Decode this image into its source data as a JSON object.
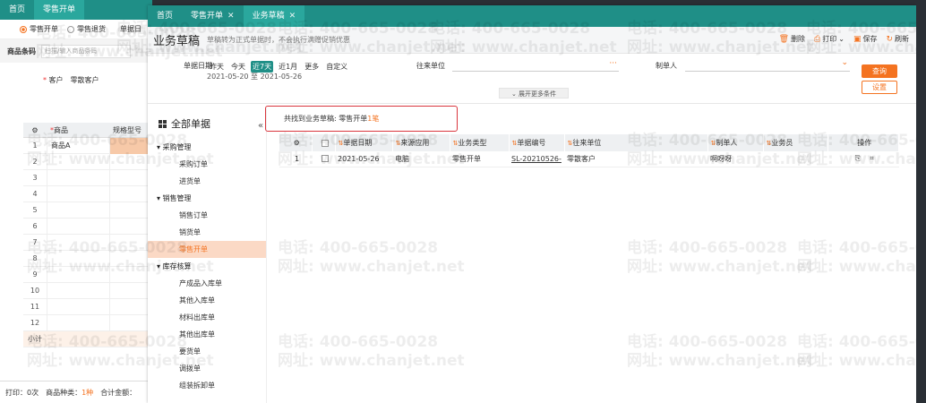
{
  "bg": {
    "tabs": [
      "首页",
      "零售开单"
    ],
    "radio": [
      "零售开单",
      "零售退货"
    ],
    "date_label": "单据日",
    "barcode_label": "商品条码",
    "barcode_placeholder": "扫描/输入商品条码",
    "customer_label": "客户",
    "customer_value": "零散客户",
    "grid_header": [
      "商品",
      "规格型号"
    ],
    "rows": [
      "1",
      "2",
      "3",
      "4",
      "5",
      "6",
      "7",
      "8",
      "9",
      "10",
      "11",
      "12"
    ],
    "first_item": "商品A",
    "subtotal": "小计",
    "footer": {
      "print": "打印：0次",
      "kinds_label": "商品种类：",
      "kinds_value": "1种",
      "amount": "合计金额："
    }
  },
  "win": {
    "tabs": [
      "首页",
      "零售开单",
      "业务草稿"
    ],
    "title": "业务草稿",
    "subtitle": "草稿转为正式单据时，不会执行满赠促销优惠",
    "actions": {
      "delete": "删除",
      "print": "打印",
      "save": "保存",
      "refresh": "刷新"
    },
    "filter": {
      "date_label": "单据日期",
      "quick": [
        "昨天",
        "今天",
        "近7天",
        "近1月",
        "更多",
        "自定义"
      ],
      "active_quick": "近7天",
      "range": "2021-05-20 至 2021-05-26",
      "partner_label": "往来单位",
      "maker_label": "制单人",
      "query": "查询",
      "settings": "设置",
      "expand": "展开更多条件"
    },
    "sidebar": {
      "all": "全部单据",
      "groups": [
        {
          "label": "采购管理",
          "items": [
            "采购订单",
            "进货单"
          ]
        },
        {
          "label": "销售管理",
          "items": [
            "销售订单",
            "销货单",
            "零售开单"
          ]
        },
        {
          "label": "库存核算",
          "items": [
            "产成品入库单",
            "其他入库单",
            "材料出库单",
            "其他出库单",
            "要货单",
            "调拨单",
            "组装拆卸单"
          ]
        }
      ],
      "active": "零售开单"
    },
    "found": {
      "prefix": "共找到业务草稿: 零售开单",
      "count": "1笔"
    },
    "table": {
      "headers": [
        "单据日期",
        "来源应用",
        "业务类型",
        "单据编号",
        "往来单位",
        "制单人",
        "业务员",
        "操作"
      ],
      "rows": [
        {
          "idx": "1",
          "date": "2021-05-26",
          "source": "电脑",
          "type": "零售开单",
          "code": "SL-20210526-",
          "partner": "零散客户",
          "maker": "啊呀呀",
          "staff": ""
        }
      ]
    }
  },
  "watermark": {
    "phone": "电话: 400-665-0028",
    "site": "网址: www.chanjet.net"
  }
}
